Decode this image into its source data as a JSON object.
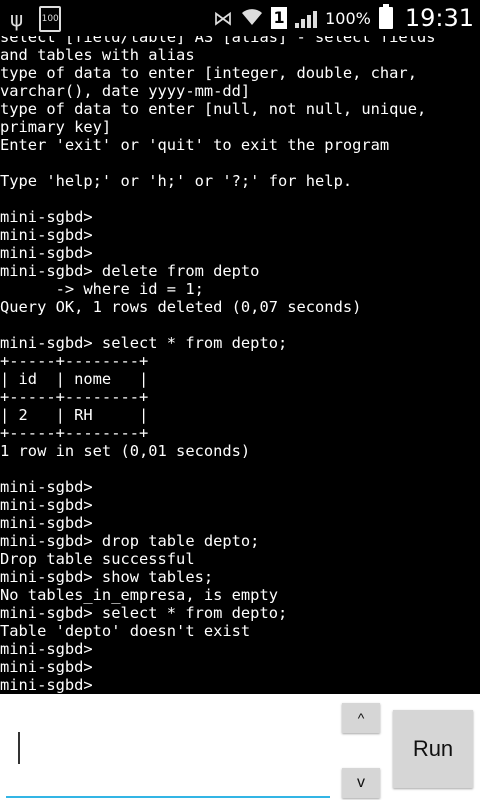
{
  "status_bar": {
    "notification_count": "100",
    "sim_slot": "1",
    "battery_percent": "100%",
    "time": "19:31"
  },
  "terminal": {
    "lines": [
      "select [field/table] AS [alias] - select fields",
      "and tables with alias",
      "type of data to enter [integer, double, char,",
      "varchar(), date yyyy-mm-dd]",
      "type of data to enter [null, not null, unique,",
      "primary key]",
      "Enter 'exit' or 'quit' to exit the program",
      "",
      "Type 'help;' or 'h;' or '?;' for help.",
      "",
      "mini-sgbd>",
      "mini-sgbd>",
      "mini-sgbd>",
      "mini-sgbd> delete from depto",
      "      -> where id = 1;",
      "Query OK, 1 rows deleted (0,07 seconds)",
      "",
      "mini-sgbd> select * from depto;",
      "+-----+--------+",
      "| id  | nome   |",
      "+-----+--------+",
      "| 2   | RH     |",
      "+-----+--------+",
      "1 row in set (0,01 seconds)",
      "",
      "mini-sgbd>",
      "mini-sgbd>",
      "mini-sgbd>",
      "mini-sgbd> drop table depto;",
      "Drop table successful",
      "mini-sgbd> show tables;",
      "No tables_in_empresa, is empty",
      "mini-sgbd> select * from depto;",
      "Table 'depto' doesn't exist",
      "mini-sgbd>",
      "mini-sgbd>",
      "mini-sgbd>"
    ]
  },
  "input": {
    "value": "",
    "placeholder": ""
  },
  "buttons": {
    "up_label": "^",
    "down_label": "v",
    "run_label": "Run"
  },
  "colors": {
    "terminal_bg": "#000000",
    "terminal_text": "#ffffff",
    "input_underline": "#33b5e5",
    "button_bg": "#d6d6d6"
  }
}
